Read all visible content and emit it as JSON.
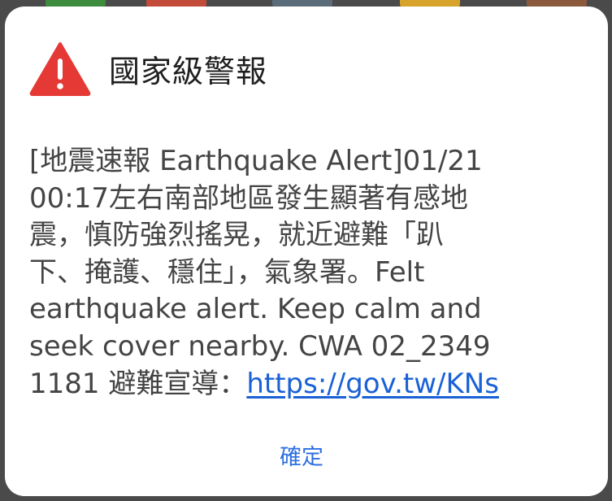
{
  "alert": {
    "icon": "warning-triangle-icon",
    "icon_color": "#e53935",
    "title": "國家級警報",
    "message_lines": [
      "[地震速報 Earthquake Alert]01/21",
      "00:17左右南部地區發生顯著有感地",
      "震，慎防強烈搖晃，就近避難「趴",
      "下、掩護、穩住」，氣象署。Felt",
      "earthquake alert. Keep calm and",
      "seek cover nearby. CWA 02_2349"
    ],
    "last_line_prefix": "1181 避難宣導：",
    "link_text": "https://gov.tw/KNs",
    "link_color": "#1a61d6",
    "confirm_label": "確定",
    "confirm_color": "#2d6fe0"
  }
}
